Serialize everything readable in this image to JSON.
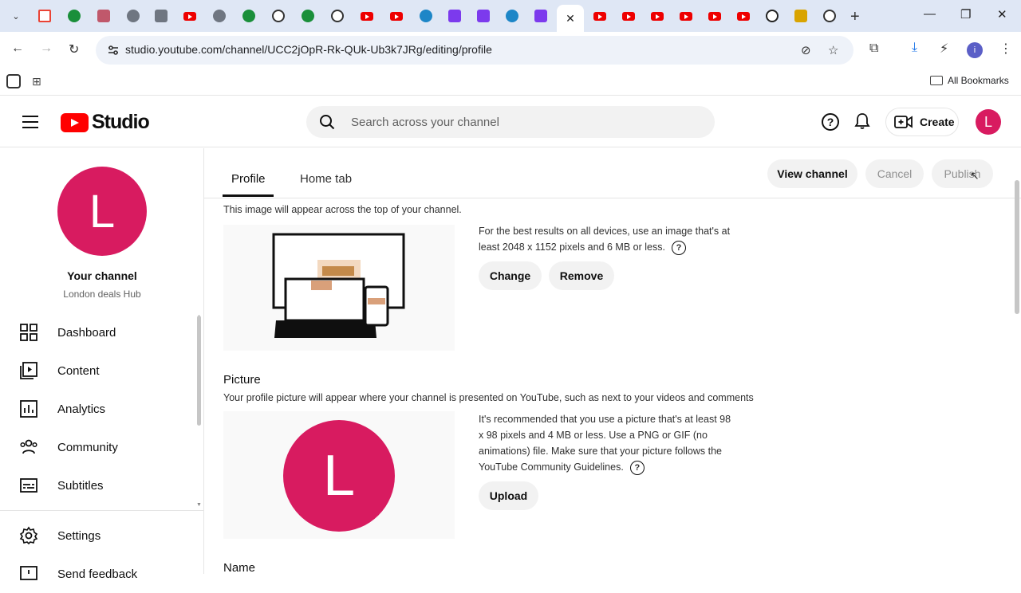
{
  "browser": {
    "url": "studio.youtube.com/channel/UCC2jOpR-Rk-QUk-Ub3k7JRg/editing/profile",
    "bookmarks_label": "All Bookmarks",
    "profile_initial": "i"
  },
  "header": {
    "logo_text": "Studio",
    "search_placeholder": "Search across your channel",
    "create_label": "Create",
    "avatar_initial": "L"
  },
  "sidebar": {
    "avatar_initial": "L",
    "channel_title": "Your channel",
    "channel_name": "London deals Hub",
    "items": [
      {
        "label": "Dashboard"
      },
      {
        "label": "Content"
      },
      {
        "label": "Analytics"
      },
      {
        "label": "Community"
      },
      {
        "label": "Subtitles"
      },
      {
        "label": "Settings"
      },
      {
        "label": "Send feedback"
      }
    ]
  },
  "main": {
    "tabs": [
      {
        "label": "Profile"
      },
      {
        "label": "Home tab"
      }
    ],
    "view_channel_label": "View channel",
    "cancel_label": "Cancel",
    "publish_label": "Publish",
    "banner": {
      "description": "This image will appear across the top of your channel.",
      "note_line1": "For the best results on all devices, use an image that's at",
      "note_line2": "least 2048 x 1152 pixels and 6 MB or less.",
      "change_label": "Change",
      "remove_label": "Remove"
    },
    "picture": {
      "title": "Picture",
      "description": "Your profile picture will appear where your channel is presented on YouTube, such as next to your videos and comments",
      "avatar_initial": "L",
      "note_line1": "It's recommended that you use a picture that's at least 98",
      "note_line2": "x 98 pixels and 4 MB or less. Use a PNG or GIF (no",
      "note_line3": "animations) file. Make sure that your picture follows the",
      "note_line4": "YouTube Community Guidelines.",
      "upload_label": "Upload"
    },
    "name_title": "Name"
  },
  "colors": {
    "avatar": "#d81b60",
    "youtube_red": "#ff0000",
    "tabstrip": "#dfe7f5"
  }
}
